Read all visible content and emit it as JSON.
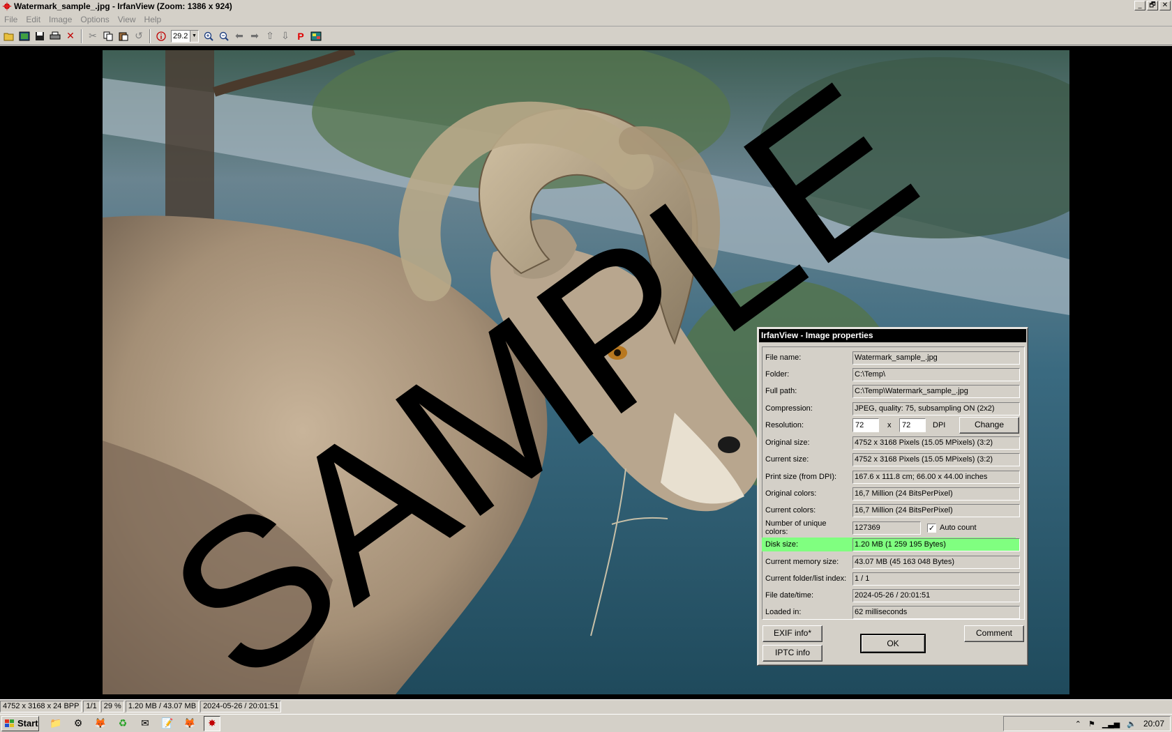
{
  "window": {
    "title": "Watermark_sample_.jpg - IrfanView (Zoom: 1386 x 924)",
    "controls": [
      "_",
      "🗗",
      "✕"
    ]
  },
  "menu": [
    "File",
    "Edit",
    "Image",
    "Options",
    "View",
    "Help"
  ],
  "toolbar": {
    "zoom_value": "29.2",
    "icons": [
      "open-icon",
      "slideshow-icon",
      "save-icon",
      "print-icon",
      "delete-icon",
      "cut-icon",
      "copy-icon",
      "paste-icon",
      "undo-icon",
      "info-icon",
      "zoom-in-icon",
      "zoom-out-icon",
      "previous-icon",
      "next-icon",
      "first-icon",
      "last-icon",
      "paint-icon",
      "thumbnails-icon"
    ]
  },
  "image": {
    "watermark_text": "SAMPLE"
  },
  "dialog": {
    "title": "IrfanView - Image properties",
    "rows": [
      {
        "label": "File name:",
        "value": "Watermark_sample_.jpg"
      },
      {
        "label": "Folder:",
        "value": "C:\\Temp\\"
      },
      {
        "label": "Full path:",
        "value": "C:\\Temp\\Watermark_sample_.jpg"
      },
      {
        "label": "Compression:",
        "value": "JPEG, quality: 75, subsampling ON (2x2)"
      },
      {
        "label": "Resolution:",
        "value": ""
      },
      {
        "label": "Original size:",
        "value": "4752 x 3168  Pixels (15.05 MPixels) (3:2)"
      },
      {
        "label": "Current size:",
        "value": "4752 x 3168  Pixels (15.05 MPixels) (3:2)"
      },
      {
        "label": "Print size (from DPI):",
        "value": "167.6 x 111.8 cm; 66.00 x 44.00 inches"
      },
      {
        "label": "Original colors:",
        "value": "16,7 Million   (24 BitsPerPixel)"
      },
      {
        "label": "Current colors:",
        "value": "16,7 Million   (24 BitsPerPixel)"
      },
      {
        "label": "Number of unique colors:",
        "value": "127369"
      },
      {
        "label": "Disk size:",
        "value": "1.20 MB (1 259 195 Bytes)"
      },
      {
        "label": "Current memory size:",
        "value": "43.07  MB (45 163 048 Bytes)"
      },
      {
        "label": "Current folder/list index:",
        "value": "1  /  1"
      },
      {
        "label": "File date/time:",
        "value": "2024-05-26 / 20:01:51"
      },
      {
        "label": "Loaded in:",
        "value": "62 milliseconds"
      }
    ],
    "resolution": {
      "x": "72",
      "sep": "x",
      "y": "72",
      "unit": "DPI",
      "change_label": "Change"
    },
    "auto_count_label": "Auto count",
    "auto_count_checked": "✓",
    "buttons": {
      "exif": "EXIF info*",
      "iptc": "IPTC info",
      "ok": "OK",
      "comment": "Comment"
    },
    "highlight_color": "#80ff80"
  },
  "status": [
    "4752 x 3168 x 24 BPP",
    "1/1",
    "29 %",
    "1.20 MB / 43.07 MB",
    "2024-05-26 / 20:01:51"
  ],
  "taskbar": {
    "start_label": "Start",
    "clock": "20:07"
  }
}
